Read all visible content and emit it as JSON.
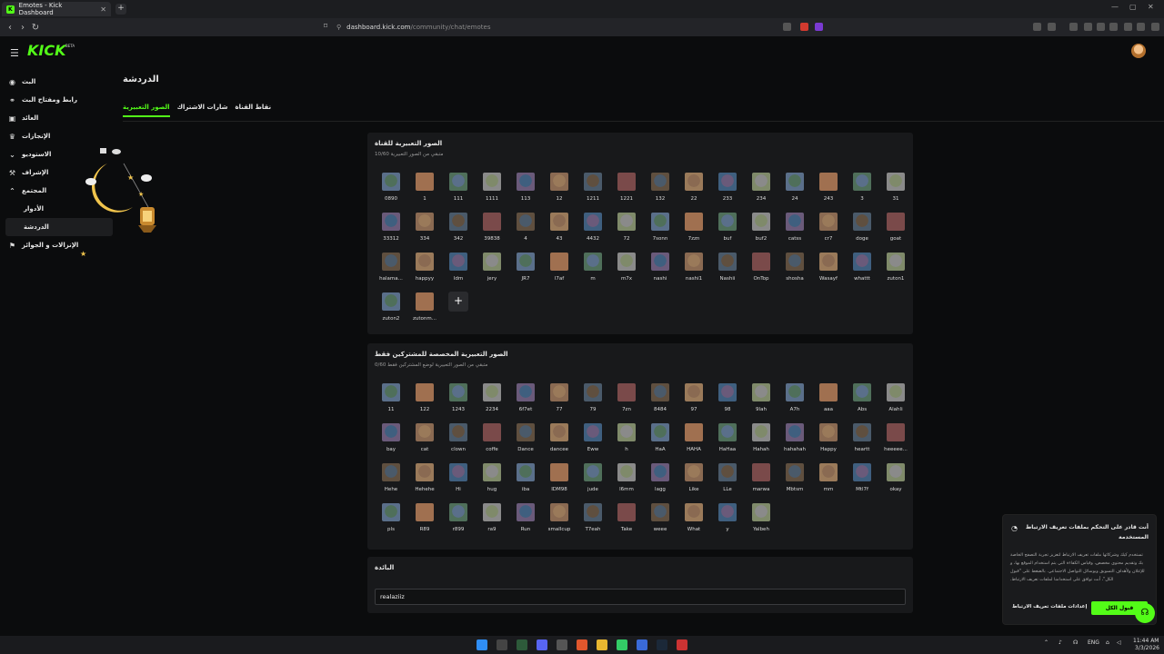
{
  "browser": {
    "tab_title": "Emotes - Kick Dashboard",
    "tab_icon": "K",
    "url_domain": "dashboard.kick.com",
    "url_path": "/community/chat/emotes"
  },
  "brand": {
    "logo": "KICK",
    "beta": "BETA",
    "accent": "#53fc18"
  },
  "sidebar": {
    "items": [
      {
        "label": "البث",
        "icon": "stream-icon"
      },
      {
        "label": "رابط ومفتاح البث",
        "icon": "link-icon"
      },
      {
        "label": "العائد",
        "icon": "revenue-icon"
      },
      {
        "label": "الإنجازات",
        "icon": "trophy-icon"
      },
      {
        "label": "الاستوديو",
        "icon": "studio-icon"
      },
      {
        "label": "الإشراف",
        "icon": "moderation-icon"
      },
      {
        "label": "المجتمع",
        "icon": "community-icon"
      }
    ],
    "sub_items": [
      "الأدوار",
      "الدردشة"
    ],
    "last_item": {
      "label": "الإنزالات و الجوائز",
      "icon": "drops-icon"
    }
  },
  "page": {
    "title": "الدردشة",
    "tabs": [
      "نقاط القناة",
      "شارات الاشتراك",
      "الصور التعبيرية"
    ]
  },
  "channel_emotes": {
    "title": "الصور التعبيرية للقناة",
    "subtitle": "متبقي من الصور التعبيرية 10/60",
    "items": [
      "0890",
      "1",
      "111",
      "1111",
      "113",
      "12",
      "1211",
      "1221",
      "132",
      "22",
      "233",
      "234",
      "24",
      "243",
      "3",
      "31",
      "33312",
      "334",
      "342",
      "39838",
      "4",
      "43",
      "4432",
      "72",
      "7sonn",
      "7zzn",
      "buf",
      "buf2",
      "catss",
      "cr7",
      "doge",
      "goat",
      "halama...",
      "happyy",
      "ldm",
      "jery",
      "JR7",
      "l7af",
      "m",
      "m7x",
      "nashi",
      "nashi1",
      "Nashii",
      "OnTop",
      "shosha",
      "Wasayf",
      "whattt",
      "zuton1",
      "zuton2",
      "zutonm..."
    ]
  },
  "sub_emotes": {
    "title": "الصور التعبيرية المخصصة للمشتركين فقط",
    "subtitle": "متبقي من الصور التعبيرية لوضع المشتركين فقط 0/60",
    "items": [
      "11",
      "122",
      "1243",
      "2234",
      "6f7et",
      "77",
      "79",
      "7zn",
      "8484",
      "97",
      "98",
      "9lah",
      "A7h",
      "aaa",
      "Abs",
      "Alahli",
      "bay",
      "cat",
      "clown",
      "coffe",
      "Dance",
      "dancee",
      "Eww",
      "h",
      "HaA",
      "HAHA",
      "HaHaa",
      "Hahah",
      "hahahah",
      "Happy",
      "heartt",
      "heeeee...",
      "Hehe",
      "Hehehe",
      "Hi",
      "hug",
      "iba",
      "IDM98",
      "jude",
      "l6mm",
      "lagg",
      "Like",
      "LLe",
      "marwa",
      "Mbtsm",
      "mm",
      "Mtl7f",
      "okay",
      "pls",
      "R89",
      "r899",
      "ra9",
      "Run",
      "smallcup",
      "T7eah",
      "Take",
      "weee",
      "What",
      "y",
      "Yalbeh"
    ]
  },
  "banned_words": {
    "title": "البائدة",
    "value": "realaziiz"
  },
  "cookie": {
    "title": "أنت قادر على التحكم بملفات تعريف الارتباط المستخدمة",
    "message": "تستخدم كيك وشركائها ملفات تعريف الارتباط لتعزيز تجربة التصفح الخاصة بك وتقديم محتوى مخصص، وقياس الكفاءة التي يتم استخدام الموقع بها، و للإعلان ولأهداف التسويق وبوسائل التواصل الاجتماعي. بالضغط على \"قبول الكل\"، أنت توافق على استخدامنا لملفات تعريف الارتباط.",
    "settings_label": "إعدادات ملفات تعريف الارتباط",
    "accept_label": "قبول الكل"
  },
  "taskbar": {
    "lang": "ENG",
    "time": "11:44 AM",
    "date": "3/3/2026"
  }
}
